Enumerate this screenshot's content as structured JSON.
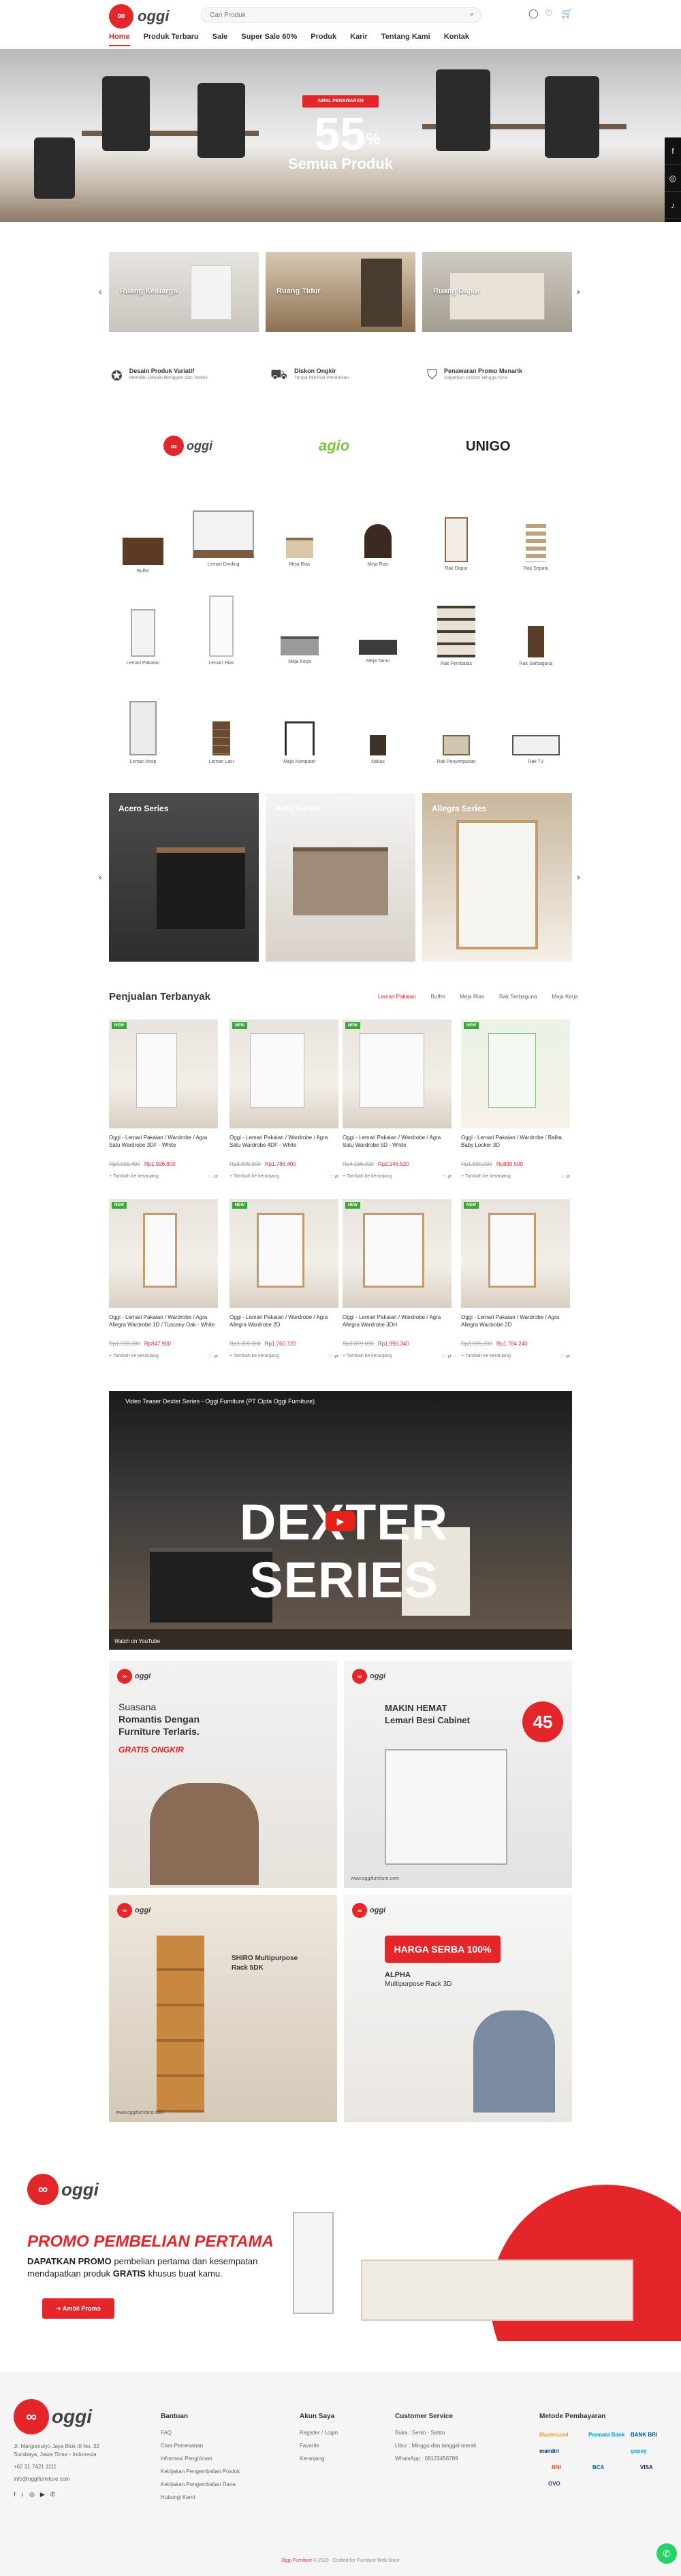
{
  "header": {
    "logo_text": "oggi",
    "search_placeholder": "Cari Produk",
    "nav": [
      "Home",
      "Produk Terbaru",
      "Sale",
      "Super Sale 60%",
      "Produk",
      "Karir",
      "Tentang Kami",
      "Kontak"
    ]
  },
  "hero": {
    "badge": "AWAL PENAWARAN",
    "big": "55",
    "sup": "%",
    "sub": "Semua Produk"
  },
  "rooms": [
    "Ruang Keluarga",
    "Ruang Tidur",
    "Ruang Dapur"
  ],
  "features": [
    {
      "title": "Desain Produk Variatif",
      "desc": "Memiliki Desain Beragam dan Terkini",
      "icon": "certificate-icon"
    },
    {
      "title": "Diskon Ongkir",
      "desc": "Tanpa Minimal Pembelian",
      "icon": "truck-icon"
    },
    {
      "title": "Penawaran Promo Menarik",
      "desc": "Dapatkan Diskon Hingga 60%",
      "icon": "tag-icon"
    }
  ],
  "brands": [
    "oggi",
    "agio",
    "UNIGO"
  ],
  "categories": [
    "Buffet",
    "Lemari Dinding",
    "Meja Rias",
    "Meja Rias",
    "Rak Dapur",
    "Rak Sepatu",
    "Lemari Pakaian",
    "Lemari Hias",
    "Meja Kerja",
    "Meja Tamu",
    "Rak Pembatas",
    "Rak Serbaguna",
    "Lemari Arsip",
    "Lemari Laci",
    "Meja Komputer",
    "Nakas",
    "Rak Penyimpanan",
    "Rak TV"
  ],
  "series": [
    "Acero Series",
    "Aldo Series",
    "Allegra Series"
  ],
  "best": {
    "title": "Penjualan Terbanyak",
    "tabs": [
      "Lemari Pakaian",
      "Buffet",
      "Meja Rias",
      "Rak Serbaguna",
      "Meja Kerja"
    ]
  },
  "products": [
    {
      "badge": "NEW",
      "name": "Oggi - Lemari Pakaian / Wardrobe / Agra Satu Wardrobe 3DF - White",
      "old": "Rp3.556.400",
      "price": "Rp1.926.800",
      "foot": "+ Tambah ke keranjang"
    },
    {
      "badge": "NEW",
      "name": "Oggi - Lemari Pakaian / Wardrobe / Agra Satu Wardrobe 4DF - White",
      "old": "Rp3.999.900",
      "price": "Rp1.786.400",
      "foot": "+ Tambah ke keranjang"
    },
    {
      "badge": "NEW",
      "name": "Oggi - Lemari Pakaian / Wardrobe / Agra Satu Wardrobe 5D - White",
      "old": "Rp4.166.000",
      "price": "Rp2.146.520",
      "foot": "+ Tambah ke keranjang"
    },
    {
      "badge": "NEW",
      "name": "Oggi - Lemari Pakaian / Wardrobe / Balita Baby Locker 3D",
      "old": "Rp1.899.000",
      "price": "Rp890.500",
      "foot": "+ Tambah ke keranjang"
    },
    {
      "badge": "NEW",
      "name": "Oggi - Lemari Pakaian / Wardrobe / Agra Allegra Wardrobe 1D / Tuscany Oak - White",
      "old": "Rp1.598.000",
      "price": "Rp847.900",
      "foot": "+ Tambah ke keranjang"
    },
    {
      "badge": "NEW",
      "name": "Oggi - Lemari Pakaian / Wardrobe / Agra Allegra Wardrobe 2D",
      "old": "Rp3.359.000",
      "price": "Rp1.760.720",
      "foot": "+ Tambah ke keranjang"
    },
    {
      "badge": "NEW",
      "name": "Oggi - Lemari Pakaian / Wardrobe / Agra Allegra Wardrobe 3DH",
      "old": "Rp3.899.000",
      "price": "Rp1.996.340",
      "foot": "+ Tambah ke keranjang"
    },
    {
      "badge": "NEW",
      "name": "Oggi - Lemari Pakaian / Wardrobe / Agra Allegra Wardrobe 2D",
      "old": "Rp3.696.000",
      "price": "Rp1.784.240",
      "foot": "+ Tambah ke keranjang"
    }
  ],
  "video": {
    "title": "Video Teaser Dexter Series - Oggi Furniture (PT Cipta Oggi Furniture)",
    "big": "DEXTER SERIES",
    "watch": "Watch on YouTube"
  },
  "banners": [
    {
      "logo": "oggi",
      "line1": "Suasana",
      "line2": "Romantis Dengan",
      "line3": "Furniture Terlaris.",
      "tag": "GRATIS ONGKIR"
    },
    {
      "logo": "oggi",
      "line1": "MAKIN HEMAT",
      "line2": "Lemari Besi Cabinet",
      "tag": "45",
      "site": "www.oggifurniture.com"
    },
    {
      "logo": "oggi",
      "line1": "SHIRO Multipurpose",
      "line2": "Rack 5DK",
      "site": "www.oggifurniture.com"
    },
    {
      "logo": "oggi",
      "line1": "HARGA SERBA 100%",
      "line2": "ALPHA",
      "line3": "Multipurpose Rack 3D"
    }
  ],
  "promo": {
    "heading": "PROMO PEMBELIAN PERTAMA",
    "desc_bold": "DAPATKAN PROMO",
    "desc": "pembelian pertama dan kesempatan mendapatkan produk",
    "desc_bold2": "GRATIS",
    "desc_end": "khusus buat kamu.",
    "button": "Ambil Promo"
  },
  "footer": {
    "address": [
      "Jl. Margomulyo Jaya Blok III No. 32",
      "Surabaya, Jawa Timur - Indonesia",
      "+62 31 7421 1111",
      "info@oggifurniture.com"
    ],
    "col1_title": "Bantuan",
    "col1": [
      "FAQ",
      "Cara Pemesanan",
      "Informasi Pengiriman",
      "Kebijakan Pengembalian Produk",
      "Kebijakan Pengembalian Dana",
      "Hubungi Kami"
    ],
    "col2_title": "Akun Saya",
    "col2": [
      "Register / Login",
      "Favorite",
      "Keranjang"
    ],
    "col3_title": "Customer Service",
    "col3": [
      "Buka : Senin - Sabtu",
      "Libur : Minggu dan tanggal merah",
      "WhatsApp : 08123456789"
    ],
    "col4_title": "Metode Pembayaran",
    "payments": [
      "Mastercard",
      "BANK BRI",
      "mandiri",
      "BNI",
      "BCA",
      "gopay",
      "VISA",
      "OVO",
      "Permata Bank"
    ],
    "copyright_prefix": "Oggi Furniture",
    "copyright": "© 2023 - Crafted for Furniture Web Store"
  },
  "colors": {
    "accent": "#e4262b",
    "green": "#39a935",
    "dark": "#222222"
  }
}
